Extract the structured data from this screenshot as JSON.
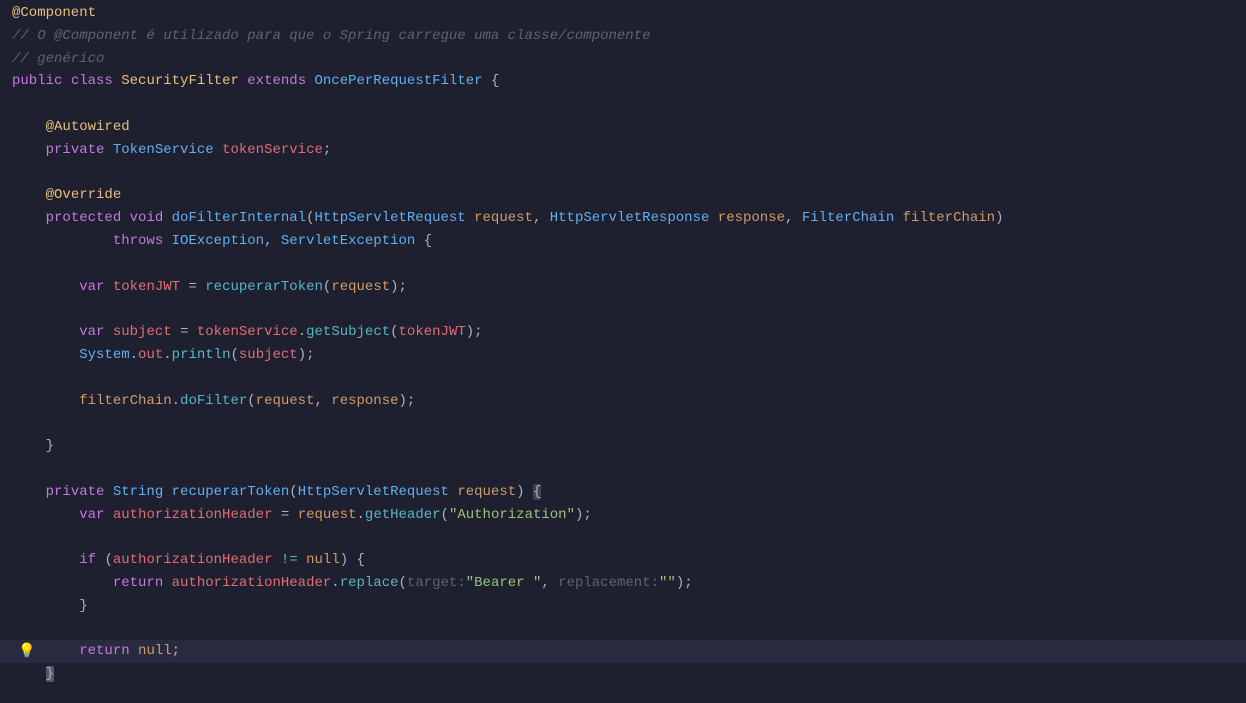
{
  "code": {
    "l1": "@Component",
    "l2": "// O @Component é utilizado para que o Spring carregue uma classe/componente",
    "l3": "// genérico",
    "l4_public": "public",
    "l4_class": "class",
    "l4_name": "SecurityFilter",
    "l4_extends": "extends",
    "l4_parent": "OncePerRequestFilter",
    "l4_brace": "{",
    "l6": "@Autowired",
    "l7_private": "private",
    "l7_type": "TokenService",
    "l7_name": "tokenService",
    "l7_semi": ";",
    "l9": "@Override",
    "l10_protected": "protected",
    "l10_void": "void",
    "l10_method": "doFilterInternal",
    "l10_p1t": "HttpServletRequest",
    "l10_p1n": "request",
    "l10_p2t": "HttpServletResponse",
    "l10_p2n": "response",
    "l10_p3t": "FilterChain",
    "l10_p3n": "filterChain",
    "l11_throws": "throws",
    "l11_e1": "IOException",
    "l11_e2": "ServletException",
    "l11_brace": "{",
    "l13_var": "var",
    "l13_name": "tokenJWT",
    "l13_eq": "=",
    "l13_call": "recuperarToken",
    "l13_arg": "request",
    "l15_var": "var",
    "l15_name": "subject",
    "l15_eq": "=",
    "l15_obj": "tokenService",
    "l15_call": "getSubject",
    "l15_arg": "tokenJWT",
    "l16_sys": "System",
    "l16_out": "out",
    "l16_println": "println",
    "l16_arg": "subject",
    "l18_obj": "filterChain",
    "l18_call": "doFilter",
    "l18_a1": "request",
    "l18_a2": "response",
    "l20_brace": "}",
    "l22_private": "private",
    "l22_ret": "String",
    "l22_method": "recuperarToken",
    "l22_p1t": "HttpServletRequest",
    "l22_p1n": "request",
    "l22_brace": "{",
    "l23_var": "var",
    "l23_name": "authorizationHeader",
    "l23_eq": "=",
    "l23_obj": "request",
    "l23_call": "getHeader",
    "l23_str": "\"Authorization\"",
    "l25_if": "if",
    "l25_cond": "authorizationHeader",
    "l25_op": "!=",
    "l25_null": "null",
    "l25_brace": "{",
    "l26_return": "return",
    "l26_obj": "authorizationHeader",
    "l26_call": "replace",
    "l26_h1": "target:",
    "l26_s1": "\"Bearer \"",
    "l26_h2": "replacement:",
    "l26_s2": "\"\"",
    "l27_brace": "}",
    "l29_return": "return",
    "l29_null": "null",
    "l30_brace": "}"
  }
}
